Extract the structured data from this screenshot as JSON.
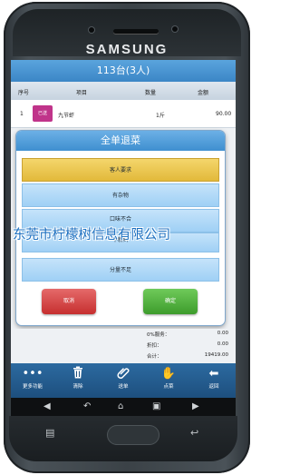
{
  "device": {
    "brand": "SAMSUNG"
  },
  "header": {
    "title": "113台(3人)"
  },
  "table": {
    "columns": [
      "序号",
      "项目",
      "数量",
      "金额"
    ],
    "rows": [
      {
        "no": "1",
        "status": "已送",
        "item": "九节虾",
        "qty": "1斤",
        "amount": "90.00"
      }
    ]
  },
  "dialog": {
    "title": "全单退菜",
    "reasons": [
      "客人要求",
      "有杂物",
      "口味不合",
      "不新鲜",
      "分量不足"
    ],
    "selected_reason": "客人要求",
    "cancel_label": "取消",
    "confirm_label": "确定"
  },
  "summary": {
    "service_label": "0%服务：",
    "service_value": "0.00",
    "discount_label": "折扣：",
    "discount_value": "0.00",
    "total_label": "合计：",
    "total_value": "19419.00"
  },
  "toolbar": {
    "items": [
      {
        "label": "更多功能",
        "icon": "more-icon"
      },
      {
        "label": "清除",
        "icon": "trash-icon"
      },
      {
        "label": "送单",
        "icon": "paperclip-icon"
      },
      {
        "label": "点菜",
        "icon": "hand-icon"
      },
      {
        "label": "返回",
        "icon": "back-arrow-icon"
      }
    ]
  },
  "watermark": "东莞市柠檬树信息有限公司",
  "colors": {
    "accent": "#3b86c6",
    "selected": "#e2b93a",
    "cancel": "#c62f2f",
    "confirm": "#3d9c2c",
    "served_badge": "#c0348a"
  }
}
